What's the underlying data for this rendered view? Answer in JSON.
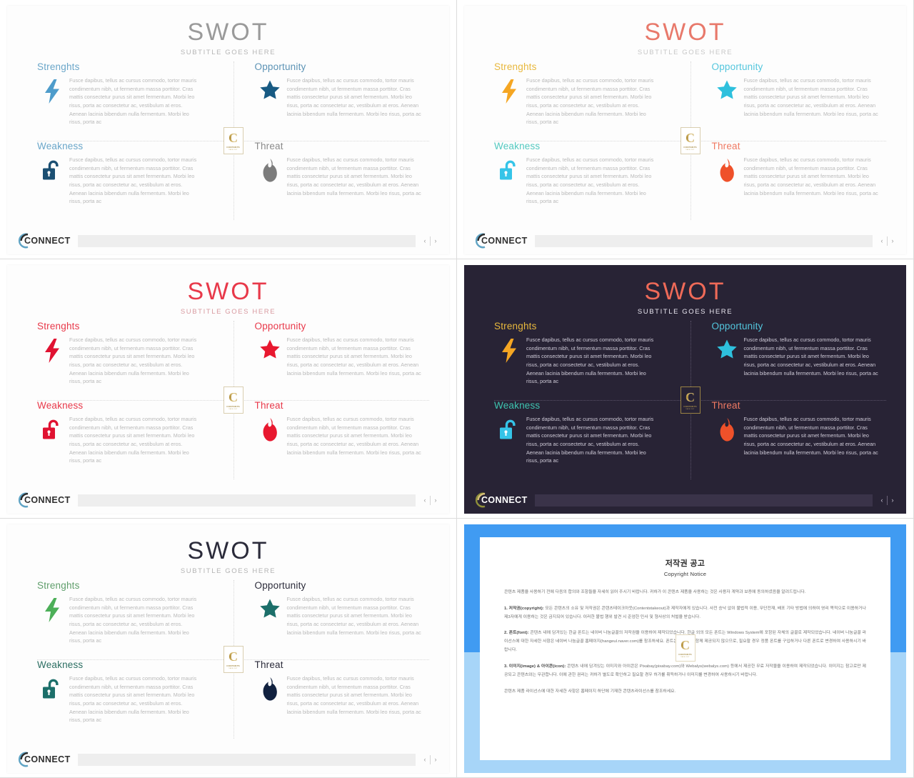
{
  "common": {
    "title": "SWOT",
    "subtitle": "SUBTITLE GOES HERE",
    "body_text": "Fusce dapibus, tellus ac cursus commodo, tortor mauris condimentum nibh, ut fermentum massa porttitor. Cras mattis consectetur purus sit amet fermentum. Morbi leo risus, porta ac consectetur ac, vestibulum at eros. Aenean lacinia bibendum nulla fermentum. Morbi leo risus, porta ac",
    "headings": {
      "strengths": "Strenghts",
      "opportunity": "Opportunity",
      "weakness": "Weakness",
      "threat": "Threat"
    },
    "badge": {
      "letter": "C",
      "line1": "CONTENTS",
      "line2": "TAKE OUT"
    },
    "footer": {
      "brand": "CONNECT",
      "prev": "‹",
      "next": "›"
    }
  },
  "slides": [
    {
      "id": "slide-1-blue",
      "theme": "light",
      "title_color": "#9a9a9a",
      "subtitle_color": "#b6b6b6",
      "heading_colors": {
        "strengths": "#6aa6c9",
        "opportunity": "#5c93b5",
        "weakness": "#6aa6c9",
        "threat": "#8a8a8a"
      },
      "icon_colors": {
        "bolt": "#4e9ccb",
        "star": "#175a83",
        "lock": "#1b4f72",
        "fire": "#7c7c7c"
      }
    },
    {
      "id": "slide-2-multicolor",
      "theme": "light",
      "title_color": "#e8796b",
      "subtitle_color": "#c8c8c8",
      "heading_colors": {
        "strengths": "#e8b83d",
        "opportunity": "#53c6dd",
        "weakness": "#53c9c0",
        "threat": "#ef7a63"
      },
      "icon_colors": {
        "bolt": "#f5a623",
        "star": "#2ec0dd",
        "lock": "#35c4e8",
        "fire": "#ef512a"
      }
    },
    {
      "id": "slide-3-red",
      "theme": "light",
      "title_color": "#e8394a",
      "subtitle_color": "#d89aa0",
      "heading_colors": {
        "strengths": "#e8394a",
        "opportunity": "#e8394a",
        "weakness": "#e8394a",
        "threat": "#e8394a"
      },
      "icon_colors": {
        "bolt": "#e01231",
        "star": "#e8182f",
        "lock": "#e01231",
        "fire": "#e8182f"
      }
    },
    {
      "id": "slide-4-dark",
      "theme": "dark",
      "title_color": "#ef6a58",
      "subtitle_color": "#e9e6f0",
      "heading_colors": {
        "strengths": "#e8b83d",
        "opportunity": "#53c6dd",
        "weakness": "#3ec4b0",
        "threat": "#ef7a63"
      },
      "icon_colors": {
        "bolt": "#f5a623",
        "star": "#2ec0dd",
        "lock": "#35c4e8",
        "fire": "#ef512a"
      }
    },
    {
      "id": "slide-5-green",
      "theme": "light",
      "title_color": "#2b2b3a",
      "subtitle_color": "#b4b4b4",
      "heading_colors": {
        "strengths": "#5f9e6b",
        "opportunity": "#2b2b3a",
        "weakness": "#2b6e62",
        "threat": "#2b2b3a"
      },
      "icon_colors": {
        "bolt": "#4caf58",
        "star": "#1c6f6a",
        "lock": "#1c6f6a",
        "fire": "#11213f"
      }
    }
  ],
  "copyright": {
    "title_ko": "저작권 공고",
    "title_en": "Copyright Notice",
    "paragraphs": [
      {
        "lead": "",
        "text": "콘텐츠 제품을 사용하기 전에 다음의 합의와 조항들을 자세히 읽어 주시기 바랍니다. 귀하가 이 콘텐츠 제품을 사용하는 것은 사용자 계약과 보증에 동의하셨음을 알려드립니다."
      },
      {
        "lead": "1. 저작권(copyright):",
        "text": " 모든 콘텐츠의 소유 및 저작권은 콘텐츠테이크아웃(Contentstakeout)과 제작자에게 있습니다. 사전 승낙 없이 불법적 이용, 무단전재, 배포 기타 방법에 의하여 영리 목적으로 이용하거나 제3자에게 이용하는 것은 금지되어 있습니다. 이러한 불법 행위 발견 시 준엄한 민사 및 형사상의 처벌을 받습니다."
      },
      {
        "lead": "2. 폰트(font):",
        "text": " 콘텐츠 내에 담겨있는 한글 폰트는 네이버 나눔글꼴의 저작권을 이용하여 제작되었습니다. 한글 외의 모든 폰트는 Windows System에 포함된 자체의 글꼴로 제작되었습니다. 네이버 나눔글꼴 라이선스에 대한 자세한 사항은 네이버 나눔글꼴 홈페이지(hangeul.naver.com)를 참조하세요. 폰트는 콘텐츠와 함께 제공되지 않으므로, 필요할 경우 정품 폰트를 구입하거나 다른 폰트로 변경하여 사용하시기 바랍니다."
      },
      {
        "lead": "3. 이미지(image) & 아이콘(icon):",
        "text": " 콘텐츠 내에 담겨있는 이미지와 아이콘은 Pixabay(pixabay.com)와 Webalys(webalys.com) 등에서 제공한 무료 저작물을 이용하여 제작되었습니다. 이미지는 참고로만 제공되고 콘텐츠와는 무관합니다. 이에 관한 권리는 귀하가 별도로 확인하고 필요할 경우 허가를 취득하거나 이미지를 변경하여 사용하시기 바랍니다."
      },
      {
        "lead": "",
        "text": "콘텐츠 제품 라이선스에 대한 자세한 사항은 홈페이지 하단에 기재한 콘텐츠라이선스를 참조하세요."
      }
    ],
    "band_top_color": "#409bf2",
    "band_bottom_color": "#a7d5f8"
  }
}
